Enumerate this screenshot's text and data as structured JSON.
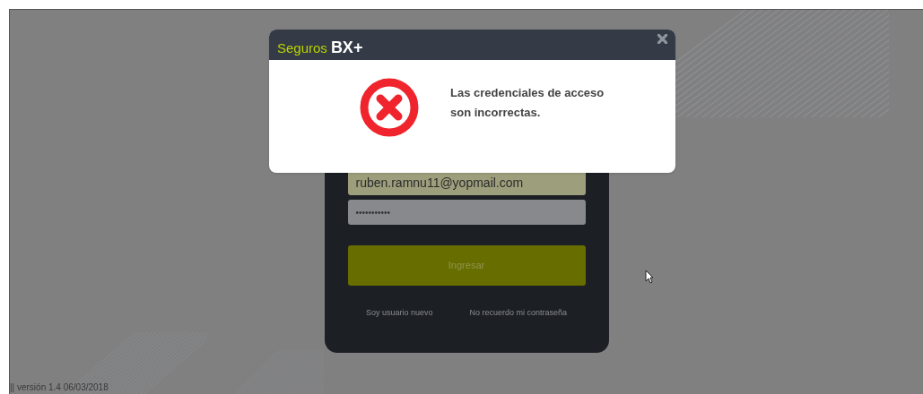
{
  "dialog": {
    "brand": "Seguros",
    "brand_mark": "BX+",
    "message": "Las credenciales de acceso son incorrectas."
  },
  "login": {
    "email": "ruben.ramnu11@yopmail.com",
    "password": "•••••••••••",
    "submit": "Ingresar",
    "links": [
      "Soy usuario nuevo",
      "No recuerdo mi contraseña"
    ]
  },
  "footer": {
    "version": "|| versión 1.4 06/03/2018"
  }
}
